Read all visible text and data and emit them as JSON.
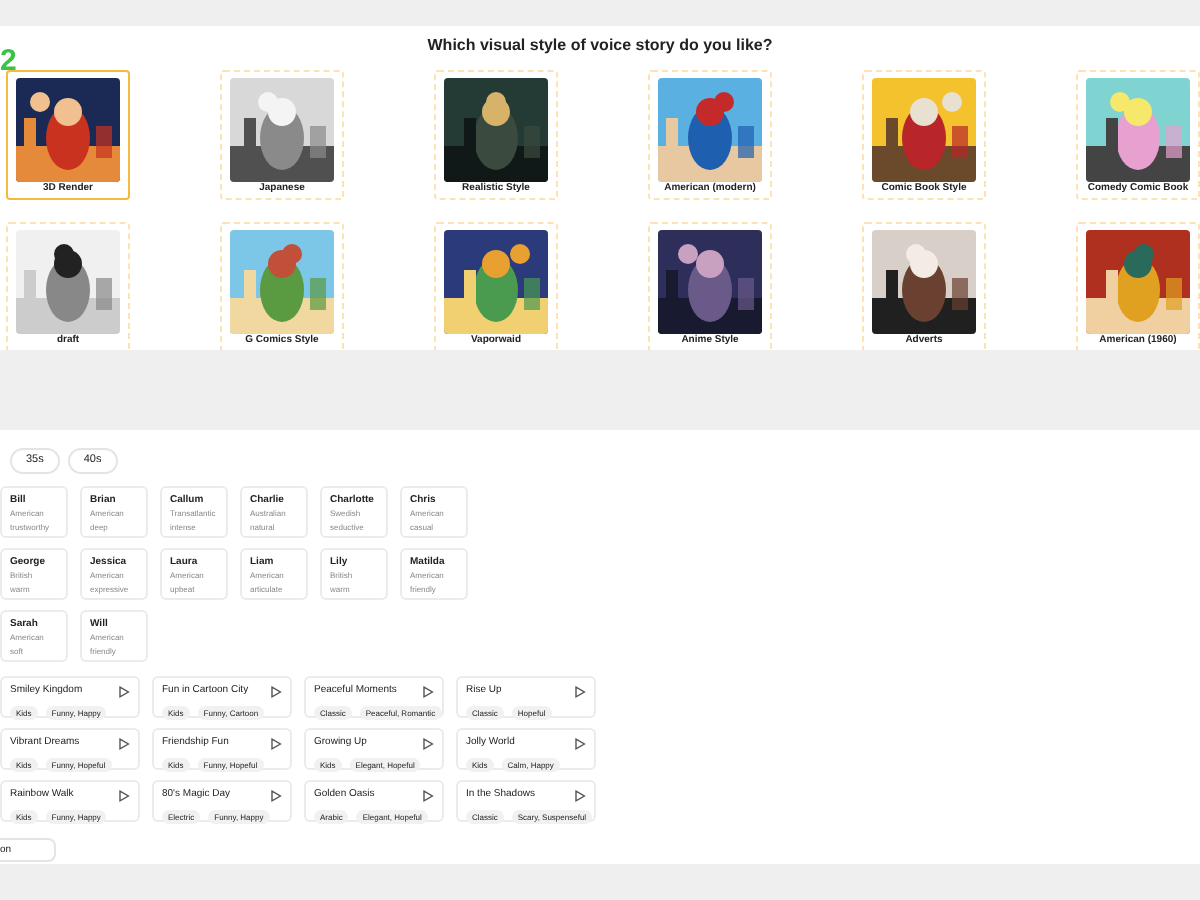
{
  "step_number": "2",
  "style_question": {
    "title": "Which visual style of voice story do you like?",
    "styles": [
      {
        "label": "3D Render",
        "selected": true
      },
      {
        "label": "Japanese",
        "selected": false
      },
      {
        "label": "Realistic Style",
        "selected": false
      },
      {
        "label": "American (modern)",
        "selected": false
      },
      {
        "label": "Comic Book Style",
        "selected": false
      },
      {
        "label": "Comedy Comic Book",
        "selected": false
      },
      {
        "label": "draft",
        "selected": false
      },
      {
        "label": "G Comics Style",
        "selected": false
      },
      {
        "label": "Vaporwaid",
        "selected": false
      },
      {
        "label": "Anime Style",
        "selected": false
      },
      {
        "label": "Adverts",
        "selected": false
      },
      {
        "label": "American (1960)",
        "selected": false
      }
    ]
  },
  "age_filters": [
    "35s",
    "40s"
  ],
  "voices": [
    {
      "name": "Bill",
      "accent": "American",
      "tone": "trustworthy"
    },
    {
      "name": "Brian",
      "accent": "American",
      "tone": "deep"
    },
    {
      "name": "Callum",
      "accent": "Transatlantic",
      "tone": "intense"
    },
    {
      "name": "Charlie",
      "accent": "Australian",
      "tone": "natural"
    },
    {
      "name": "Charlotte",
      "accent": "Swedish",
      "tone": "seductive"
    },
    {
      "name": "Chris",
      "accent": "American",
      "tone": "casual"
    },
    {
      "name": "George",
      "accent": "British",
      "tone": "warm"
    },
    {
      "name": "Jessica",
      "accent": "American",
      "tone": "expressive"
    },
    {
      "name": "Laura",
      "accent": "American",
      "tone": "upbeat"
    },
    {
      "name": "Liam",
      "accent": "American",
      "tone": "articulate"
    },
    {
      "name": "Lily",
      "accent": "British",
      "tone": "warm"
    },
    {
      "name": "Matilda",
      "accent": "American",
      "tone": "friendly"
    },
    {
      "name": "Sarah",
      "accent": "American",
      "tone": "soft"
    },
    {
      "name": "Will",
      "accent": "American",
      "tone": "friendly"
    }
  ],
  "music": [
    {
      "title": "Smiley Kingdom",
      "tags": [
        "Kids",
        "Funny, Happy"
      ]
    },
    {
      "title": "Fun in Cartoon City",
      "tags": [
        "Kids",
        "Funny, Cartoon"
      ]
    },
    {
      "title": "Peaceful Moments",
      "tags": [
        "Classic",
        "Peaceful, Romantic"
      ]
    },
    {
      "title": "Rise Up",
      "tags": [
        "Classic",
        "Hopeful"
      ]
    },
    {
      "title": "Vibrant Dreams",
      "tags": [
        "Kids",
        "Funny, Hopeful"
      ]
    },
    {
      "title": "Friendship Fun",
      "tags": [
        "Kids",
        "Funny, Hopeful"
      ]
    },
    {
      "title": "Growing Up",
      "tags": [
        "Kids",
        "Elegant, Hopeful"
      ]
    },
    {
      "title": "Jolly World",
      "tags": [
        "Kids",
        "Calm, Happy"
      ]
    },
    {
      "title": "Rainbow Walk",
      "tags": [
        "Kids",
        "Funny, Happy"
      ]
    },
    {
      "title": "80's Magic Day",
      "tags": [
        "Electric",
        "Funny, Happy"
      ]
    },
    {
      "title": "Golden Oasis",
      "tags": [
        "Arabic",
        "Elegant, Hopeful"
      ]
    },
    {
      "title": "In the Shadows",
      "tags": [
        "Classic",
        "Scary, Suspenseful"
      ]
    }
  ],
  "partial_chip": "on"
}
